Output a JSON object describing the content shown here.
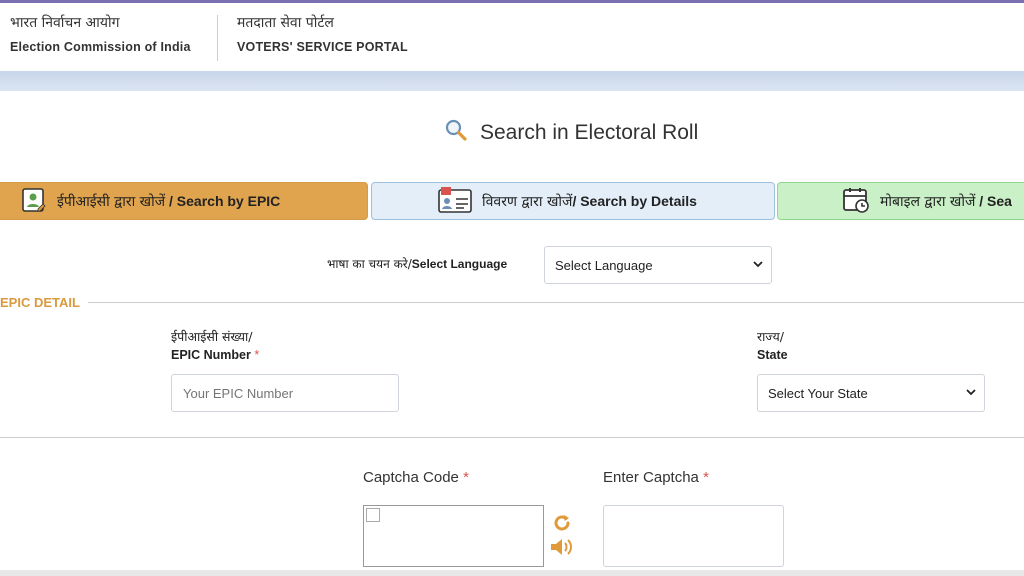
{
  "header": {
    "org_hindi": "भारत निर्वाचन आयोग",
    "org_english": "Election Commission of India",
    "portal_hindi": "मतदाता सेवा पोर्टल",
    "portal_english": "VOTERS' SERVICE PORTAL"
  },
  "page": {
    "title": "Search in Electoral Roll"
  },
  "tabs": [
    {
      "hindi": "ईपीआईसी द्वारा खोजें",
      "english": " / Search by EPIC",
      "active": true,
      "color": "#e0a44e"
    },
    {
      "hindi": "विवरण द्वारा खोजें",
      "english": "/ Search by Details",
      "active": false,
      "color": "#e3eef8"
    },
    {
      "hindi": "मोबाइल द्वारा खोजें",
      "english": " / Sea",
      "active": false,
      "color": "#c9f0c6"
    }
  ],
  "language": {
    "label_hindi": "भाषा का चयन करे/",
    "label_english": "Select Language",
    "selected": "Select Language"
  },
  "epic_detail": {
    "section_title": "EPIC DETAIL",
    "epic_label_hindi": "ईपीआईसी संख्या/",
    "epic_label_english": "EPIC Number",
    "epic_placeholder": "Your EPIC Number",
    "state_label_hindi": "राज्य/",
    "state_label_english": "State",
    "state_selected": "Select Your State",
    "required_mark": "*"
  },
  "captcha": {
    "code_label": "Captcha Code",
    "enter_label": "Enter Captcha",
    "required_mark": "*"
  },
  "colors": {
    "accent": "#d99a3e",
    "required": "#d9534f",
    "header_band": "#c9d6ea"
  }
}
